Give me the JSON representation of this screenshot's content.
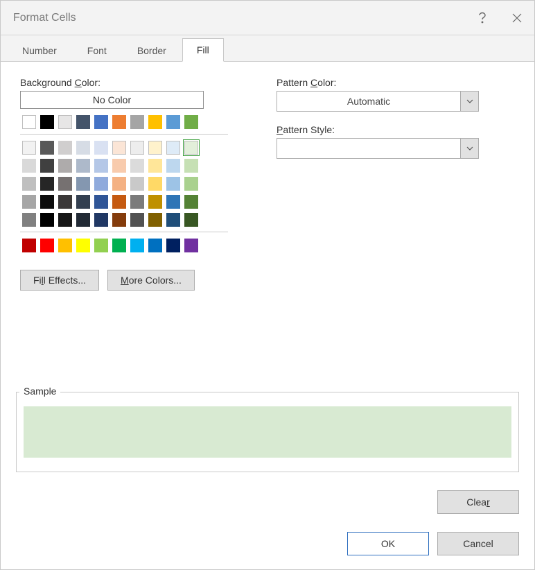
{
  "dialog": {
    "title": "Format Cells"
  },
  "tabs": {
    "number": "Number",
    "font": "Font",
    "border": "Border",
    "fill": "Fill"
  },
  "fill": {
    "bg_label_pre": "Background ",
    "bg_label_u": "C",
    "bg_label_post": "olor:",
    "no_color": "No Color",
    "fill_effects_pre": "Fi",
    "fill_effects_u": "l",
    "fill_effects_post": "l Effects...",
    "more_colors_u": "M",
    "more_colors_post": "ore Colors...",
    "pattern_color_pre": "Pattern ",
    "pattern_color_u": "C",
    "pattern_color_post": "olor:",
    "pattern_color_value": "Automatic",
    "pattern_style_u": "P",
    "pattern_style_post": "attern Style:",
    "pattern_style_value": ""
  },
  "palette": {
    "row0": [
      "#ffffff",
      "#000000",
      "#e7e6e6",
      "#44546a",
      "#4472c4",
      "#ed7d31",
      "#a5a5a5",
      "#ffc000",
      "#5b9bd5",
      "#70ad47"
    ],
    "tints": [
      [
        "#f2f2f2",
        "#595959",
        "#d0cece",
        "#d6dce5",
        "#d9e1f2",
        "#fbe5d6",
        "#ededed",
        "#fff2cc",
        "#deebf7",
        "#e2efda"
      ],
      [
        "#d9d9d9",
        "#404040",
        "#aeabab",
        "#adb9ca",
        "#b4c7e7",
        "#f8cbad",
        "#dbdbdb",
        "#ffe699",
        "#bdd7ee",
        "#c6e0b4"
      ],
      [
        "#bfbfbf",
        "#262626",
        "#767171",
        "#8497b0",
        "#8faadc",
        "#f4b183",
        "#c9c9c9",
        "#ffd966",
        "#9dc3e6",
        "#a9d18e"
      ],
      [
        "#a6a6a6",
        "#0d0d0d",
        "#3b3838",
        "#333f50",
        "#2f5597",
        "#c55a11",
        "#7b7b7b",
        "#bf9000",
        "#2e75b6",
        "#548235"
      ],
      [
        "#808080",
        "#000000",
        "#171717",
        "#222a35",
        "#203864",
        "#843c0c",
        "#525252",
        "#806000",
        "#1f4e79",
        "#385723"
      ]
    ],
    "standard": [
      "#c00000",
      "#ff0000",
      "#ffc000",
      "#ffff00",
      "#92d050",
      "#00b050",
      "#00b0f0",
      "#0070c0",
      "#002060",
      "#7030a0"
    ],
    "selected": "#e2efda"
  },
  "sample": {
    "legend": "Sample",
    "color": "#d8ead2"
  },
  "buttons": {
    "clear_pre": "Clea",
    "clear_u": "r",
    "ok": "OK",
    "cancel": "Cancel"
  }
}
